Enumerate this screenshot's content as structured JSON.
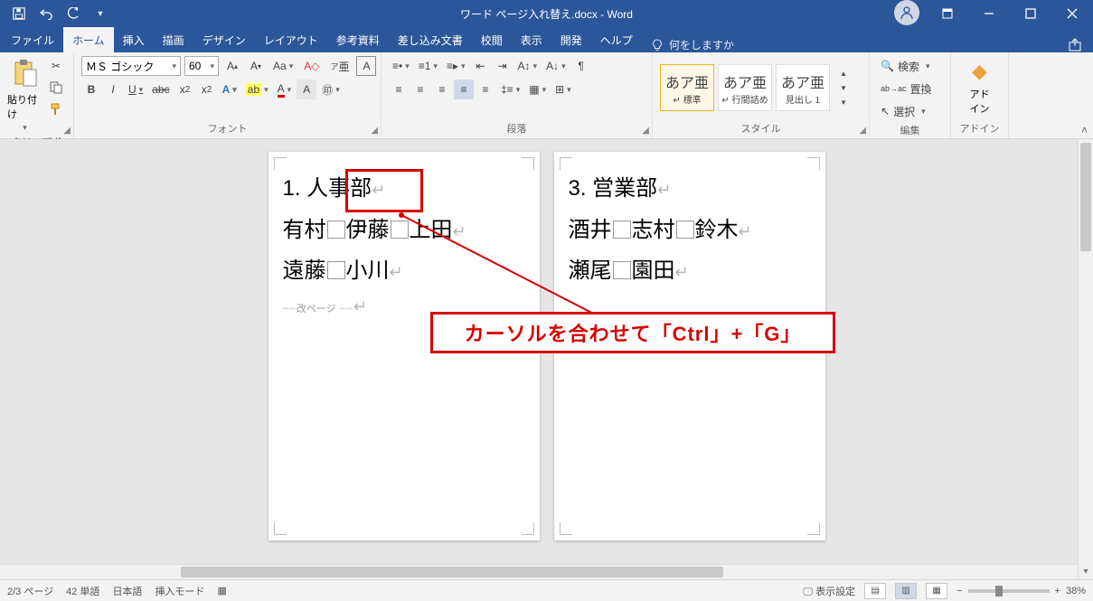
{
  "titlebar": {
    "title": "ワード ページ入れ替え.docx  -  Word"
  },
  "tabs": {
    "file": "ファイル",
    "home": "ホーム",
    "insert": "挿入",
    "draw": "描画",
    "design": "デザイン",
    "layout": "レイアウト",
    "references": "参考資料",
    "mailings": "差し込み文書",
    "review": "校閲",
    "view": "表示",
    "developer": "開発",
    "help": "ヘルプ",
    "tellme": "何をしますか"
  },
  "ribbon": {
    "clipboard": {
      "label": "クリップボード",
      "paste": "貼り付け"
    },
    "font": {
      "label": "フォント",
      "name": "ＭＳ ゴシック",
      "size": "60",
      "bold": "B",
      "italic": "I",
      "underline": "U"
    },
    "paragraph": {
      "label": "段落"
    },
    "styles": {
      "label": "スタイル",
      "items": [
        {
          "sample": "あア亜",
          "name": "↵ 標準"
        },
        {
          "sample": "あア亜",
          "name": "↵ 行間詰め"
        },
        {
          "sample": "あア亜",
          "name": "見出し 1"
        }
      ]
    },
    "editing": {
      "label": "編集",
      "find": "検索",
      "replace": "置換",
      "select": "選択"
    },
    "addins": {
      "label": "アドイン",
      "btn": "アド\nイン"
    }
  },
  "pages": [
    {
      "h": "1. 人事部",
      "l2a": "有村",
      "l2b": "伊藤",
      "l2c": "上田",
      "l3a": "遠藤",
      "l3b": "小川",
      "break": "改ページ"
    },
    {
      "h": "3. 営業部",
      "l2a": "酒井",
      "l2b": "志村",
      "l2c": "鈴木",
      "l3a": "瀬尾",
      "l3b": "園田"
    }
  ],
  "status": {
    "page": "2/3 ページ",
    "words": "42 単語",
    "lang": "日本語",
    "mode": "挿入モード",
    "display": "表示設定",
    "zoom": "38%"
  },
  "annotation": {
    "text": "カーソルを合わせて「Ctrl」+「G」"
  }
}
